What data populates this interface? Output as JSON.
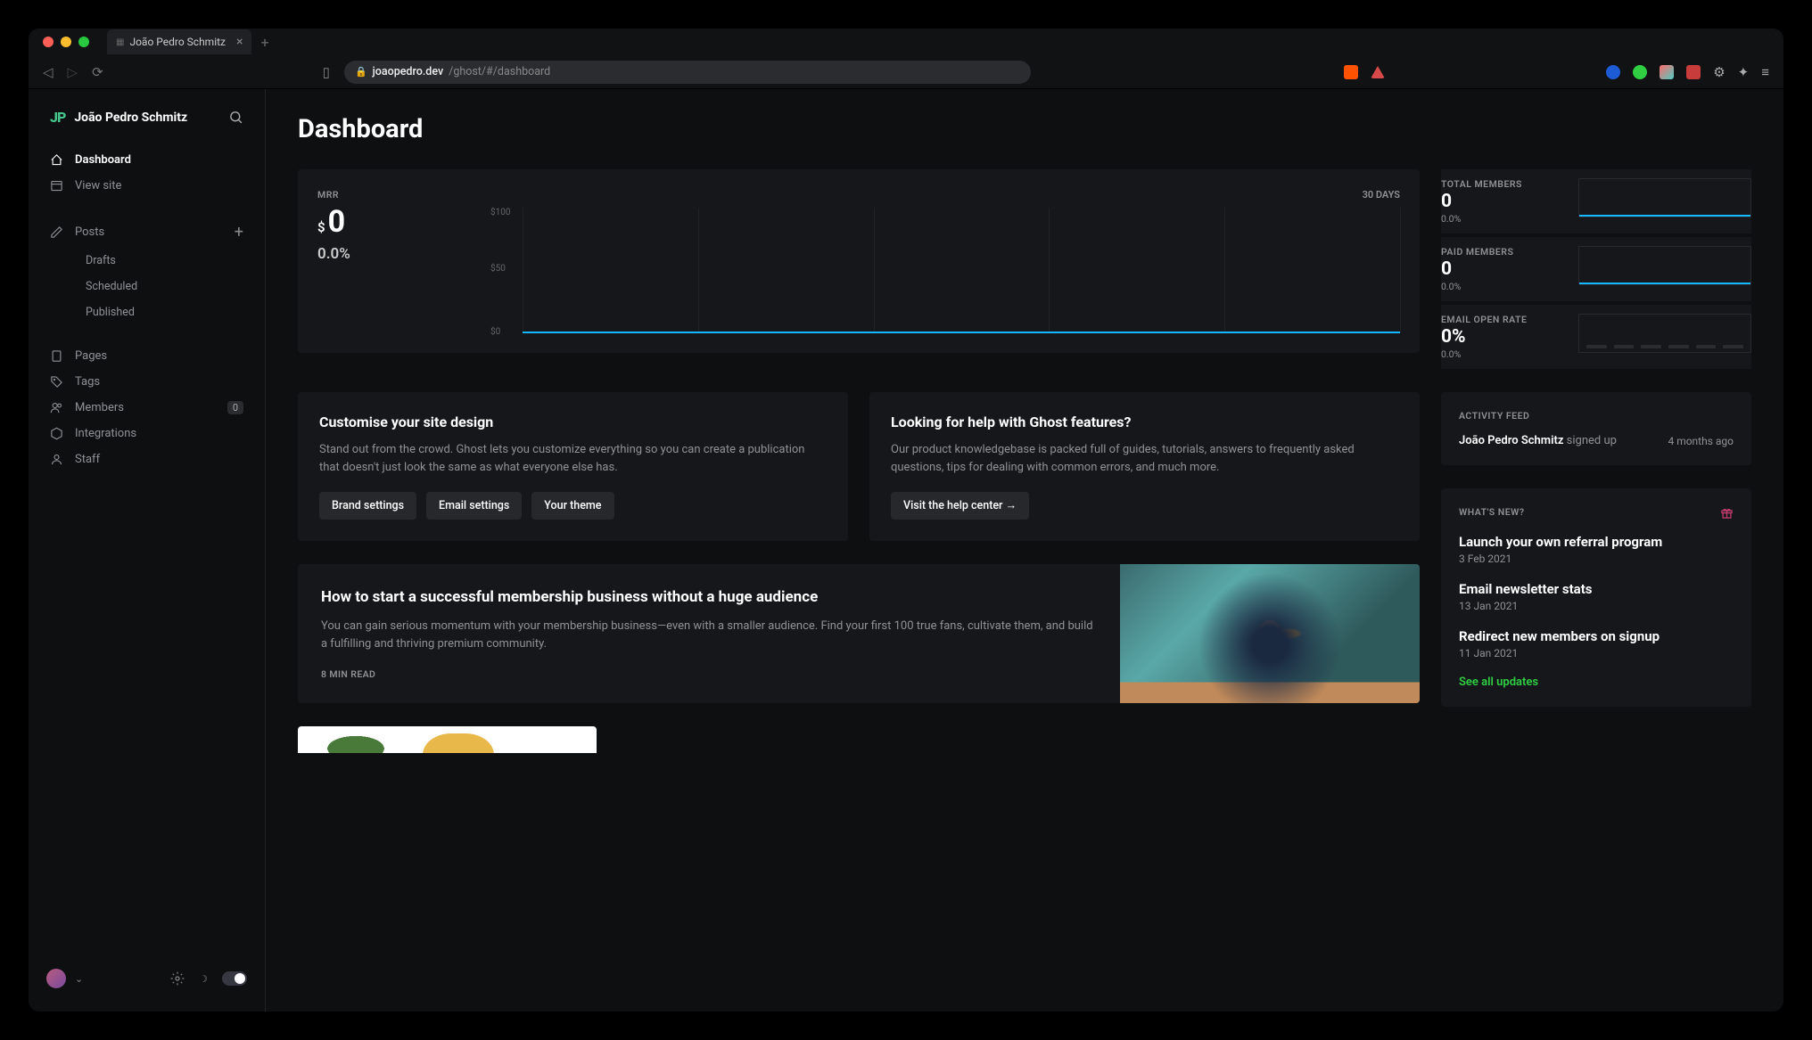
{
  "browser": {
    "tab_title": "João Pedro Schmitz",
    "url_host": "joaopedro.dev",
    "url_path": "/ghost/#/dashboard"
  },
  "sidebar": {
    "brand_logo": "JP",
    "brand_name": "João Pedro Schmitz",
    "items": [
      {
        "icon": "home",
        "label": "Dashboard",
        "active": true
      },
      {
        "icon": "view",
        "label": "View site"
      },
      {
        "icon": "edit",
        "label": "Posts",
        "plus": true
      },
      {
        "sub": true,
        "label": "Drafts"
      },
      {
        "sub": true,
        "label": "Scheduled"
      },
      {
        "sub": true,
        "label": "Published"
      },
      {
        "icon": "page",
        "label": "Pages"
      },
      {
        "icon": "tag",
        "label": "Tags"
      },
      {
        "icon": "members",
        "label": "Members",
        "badge": "0"
      },
      {
        "icon": "integ",
        "label": "Integrations"
      },
      {
        "icon": "staff",
        "label": "Staff"
      }
    ]
  },
  "page": {
    "title": "Dashboard"
  },
  "mrr": {
    "label": "MRR",
    "currency": "$",
    "value": "0",
    "delta": "0.0%",
    "period": "30 DAYS"
  },
  "chart_data": {
    "type": "line",
    "title": "MRR",
    "ylabel": "$",
    "ylim": [
      0,
      100
    ],
    "y_ticks": [
      "$100",
      "$50",
      "$0"
    ],
    "x": [
      0,
      1,
      2,
      3,
      4,
      5,
      6,
      7,
      8,
      9,
      10,
      11,
      12,
      13,
      14,
      15,
      16,
      17,
      18,
      19,
      20,
      21,
      22,
      23,
      24,
      25,
      26,
      27,
      28,
      29
    ],
    "values": [
      0,
      0,
      0,
      0,
      0,
      0,
      0,
      0,
      0,
      0,
      0,
      0,
      0,
      0,
      0,
      0,
      0,
      0,
      0,
      0,
      0,
      0,
      0,
      0,
      0,
      0,
      0,
      0,
      0,
      0
    ]
  },
  "stats": [
    {
      "label": "TOTAL MEMBERS",
      "value": "0",
      "delta": "0.0%"
    },
    {
      "label": "PAID MEMBERS",
      "value": "0",
      "delta": "0.0%"
    },
    {
      "label": "EMAIL OPEN RATE",
      "value": "0%",
      "delta": "0.0%"
    }
  ],
  "cards": {
    "customise": {
      "title": "Customise your site design",
      "text": "Stand out from the crowd. Ghost lets you customize everything so you can create a publication that doesn't just look the same as what everyone else has.",
      "btn1": "Brand settings",
      "btn2": "Email settings",
      "btn3": "Your theme"
    },
    "help": {
      "title": "Looking for help with Ghost features?",
      "text": "Our product knowledgebase is packed full of guides, tutorials, answers to frequently asked questions, tips for dealing with common errors, and much more.",
      "btn": "Visit the help center →"
    }
  },
  "activity": {
    "label": "ACTIVITY FEED",
    "user": "João Pedro Schmitz",
    "action": "signed up",
    "time": "4 months ago"
  },
  "news": {
    "label": "WHAT'S NEW?",
    "items": [
      {
        "title": "Launch your own referral program",
        "date": "3 Feb 2021"
      },
      {
        "title": "Email newsletter stats",
        "date": "13 Jan 2021"
      },
      {
        "title": "Redirect new members on signup",
        "date": "11 Jan 2021"
      }
    ],
    "see_all": "See all updates"
  },
  "article": {
    "title": "How to start a successful membership business without a huge audience",
    "text": "You can gain serious momentum with your membership business—even with a smaller audience. Find your first 100 true fans, cultivate them, and build a fulfilling and thriving premium community.",
    "read": "8 MIN READ"
  }
}
